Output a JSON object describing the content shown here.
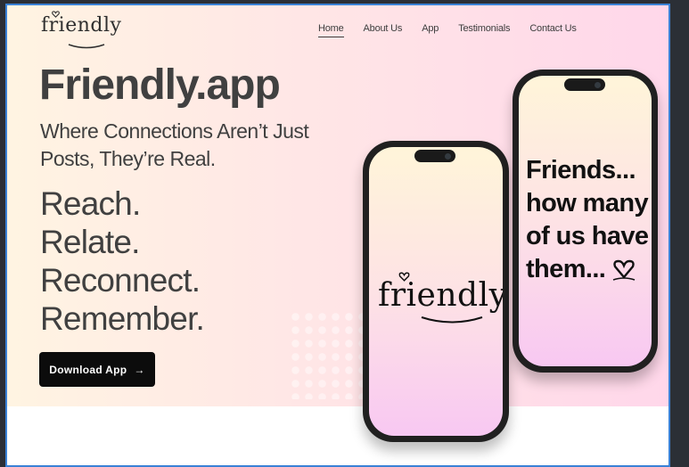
{
  "brand": {
    "logo_text": "friendly"
  },
  "nav": {
    "items": [
      {
        "label": "Home",
        "active": true
      },
      {
        "label": "About Us"
      },
      {
        "label": "App"
      },
      {
        "label": "Testimonials"
      },
      {
        "label": "Contact Us"
      }
    ]
  },
  "hero": {
    "title": "Friendly.app",
    "subtitle": "Where Connections Aren’t Just Posts, They’re Real.",
    "tagline": [
      "Reach.",
      "Relate.",
      "Reconnect.",
      "Remember."
    ],
    "cta_label": "Download App",
    "cta_icon": "arrow-right-icon"
  },
  "phones": {
    "left": {
      "logo_text": "friendly"
    },
    "right": {
      "quote": [
        "Friends...",
        "how many",
        "of us have",
        "them..."
      ]
    }
  },
  "colors": {
    "accent": "#0c0c0c",
    "text": "#404040",
    "frame": "#3a82d6"
  }
}
